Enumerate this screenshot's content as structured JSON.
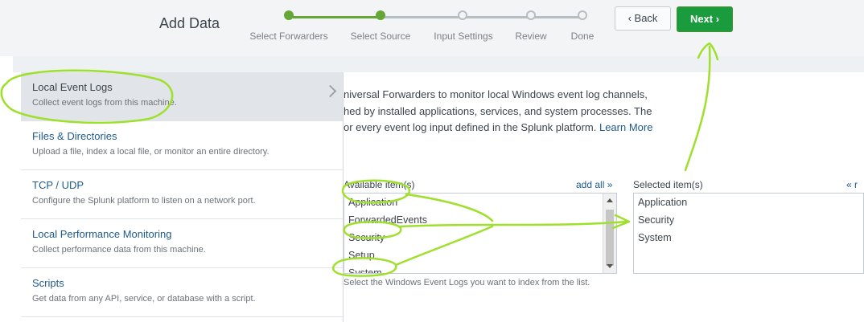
{
  "header": {
    "title": "Add Data",
    "back_label": "‹ Back",
    "next_label": "Next ›",
    "steps": [
      {
        "label": "Select Forwarders",
        "state": "done"
      },
      {
        "label": "Select Source",
        "state": "done"
      },
      {
        "label": "Input Settings",
        "state": "todo"
      },
      {
        "label": "Review",
        "state": "todo"
      },
      {
        "label": "Done",
        "state": "todo"
      }
    ]
  },
  "sidebar": {
    "items": [
      {
        "title": "Local Event Logs",
        "desc": "Collect event logs from this machine.",
        "active": true
      },
      {
        "title": "Files & Directories",
        "desc": "Upload a file, index a local file, or monitor an entire directory.",
        "active": false
      },
      {
        "title": "TCP / UDP",
        "desc": "Configure the Splunk platform to listen on a network port.",
        "active": false
      },
      {
        "title": "Local Performance Monitoring",
        "desc": "Collect performance data from this machine.",
        "active": false
      },
      {
        "title": "Scripts",
        "desc": "Get data from any API, service, or database with a script.",
        "active": false
      }
    ]
  },
  "main": {
    "para_lines": [
      "niversal Forwarders to monitor local Windows event log channels,",
      "hed by installed applications, services, and system processes. The",
      "or every event log input defined in the Splunk platform. "
    ],
    "learn_more": "Learn More",
    "available_label": "Available item(s)",
    "add_all": "add all »",
    "selected_label": "Selected item(s)",
    "remove_all": "« r",
    "available_items": [
      "Application",
      "ForwardedEvents",
      "Security",
      "Setup",
      "System"
    ],
    "selected_items": [
      "Application",
      "Security",
      "System"
    ],
    "help_text": "Select the Windows Event Logs you want to index from the list."
  },
  "colors": {
    "accent_green": "#65a637",
    "next_button": "#1a9c3e",
    "link": "#1e5b8e",
    "annotation": "#9ee02b"
  }
}
